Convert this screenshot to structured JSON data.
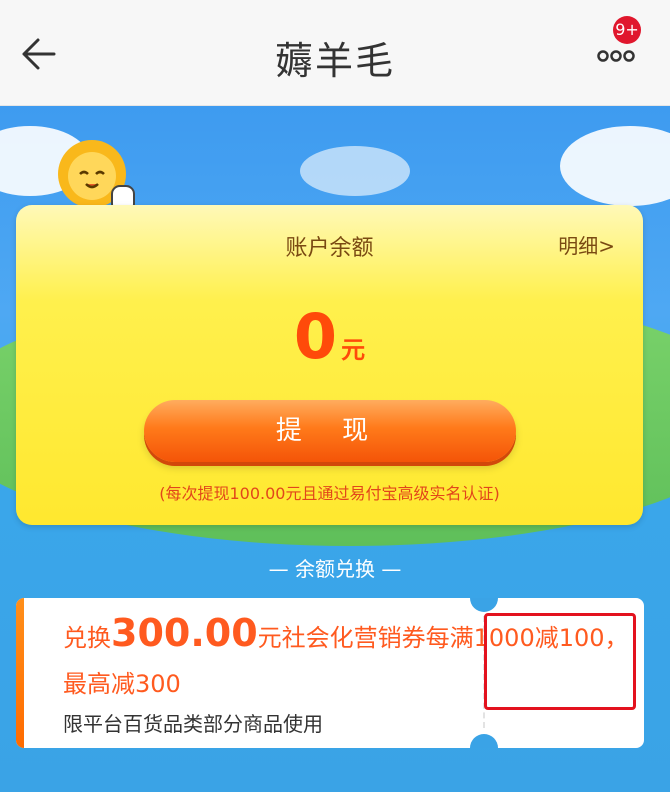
{
  "header": {
    "title": "薅羊毛",
    "badge": "9+",
    "back_icon": "arrow-left-icon",
    "more_icon": "more-dots-icon"
  },
  "balance_card": {
    "title": "账户余额",
    "detail_link": "明细>",
    "amount_value": "0",
    "amount_unit": "元",
    "withdraw_button": "提 现",
    "withdraw_note": "(每次提现100.00元且通过易付宝高级实名认证)"
  },
  "exchange": {
    "section_title": "— 余额兑换 —"
  },
  "coupon": {
    "prefix": "兑换",
    "amount": "300.00",
    "description": "元社会化营销券每满1000减100，最高减300",
    "sub": "限平台百货品类部分商品使用"
  },
  "colors": {
    "accent_orange": "#ff5a1f",
    "badge_red": "#e0172d",
    "card_yellow": "#ffe82f",
    "highlight_red": "#e3121e"
  }
}
